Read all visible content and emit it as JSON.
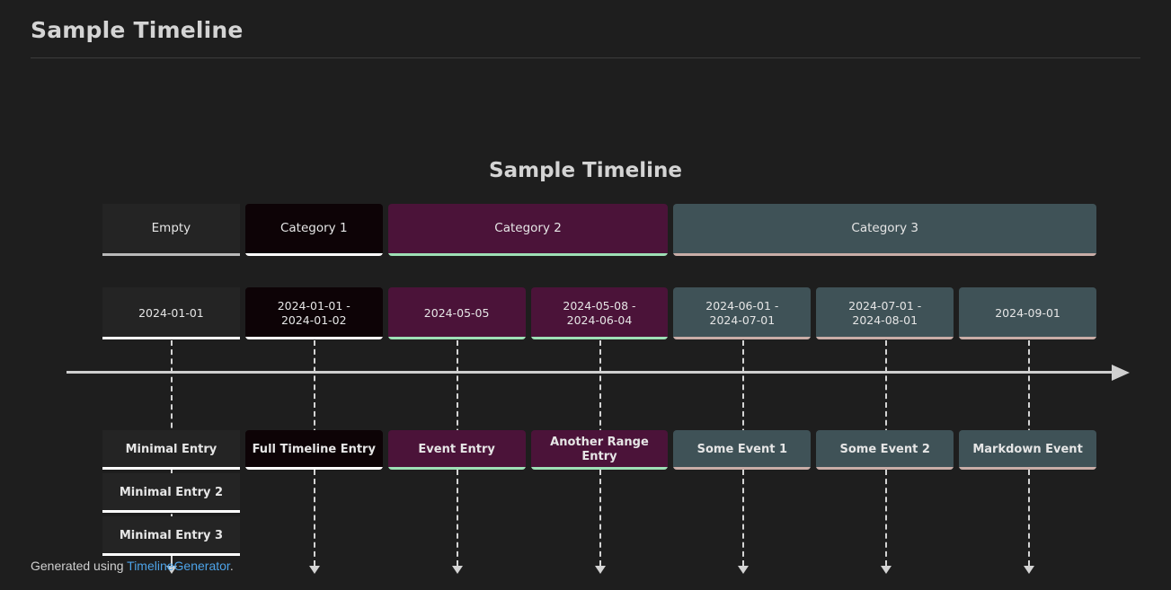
{
  "page": {
    "header_title": "Sample Timeline",
    "background_color": "#1e1e1e"
  },
  "chart_data": {
    "type": "table",
    "title": "Sample Timeline",
    "xlabel": "",
    "ylabel": "",
    "grid": false,
    "legend": "none",
    "axis": {
      "style": "arrow-right",
      "color": "#cfcfcf"
    },
    "categories": [
      {
        "label": "Empty",
        "bg_color": "#242424",
        "accent_color": "#b9b9b9",
        "span_columns": 1
      },
      {
        "label": "Category 1",
        "bg_color": "#0d0306",
        "accent_color": "#ffffff",
        "span_columns": 1
      },
      {
        "label": "Category 2",
        "bg_color": "#4b1339",
        "accent_color": "#9ee0b6",
        "span_columns": 2
      },
      {
        "label": "Category 3",
        "bg_color": "#3f5257",
        "accent_color": "#c9ada7",
        "span_columns": 3
      }
    ],
    "columns": [
      {
        "date": "2024-01-01",
        "event": "Minimal Entry",
        "category": "Empty",
        "bg_color": "#242424",
        "accent_color": "#ffffff",
        "extra_events": [
          "Minimal Entry 2",
          "Minimal Entry 3"
        ]
      },
      {
        "date": "2024-01-01 -\n2024-01-02",
        "event": "Full Timeline Entry",
        "category": "Category 1",
        "bg_color": "#0d0306",
        "accent_color": "#ffffff",
        "extra_events": []
      },
      {
        "date": "2024-05-05",
        "event": "Event Entry",
        "category": "Category 2",
        "bg_color": "#4b1339",
        "accent_color": "#9ee0b6",
        "extra_events": []
      },
      {
        "date": "2024-05-08 -\n2024-06-04",
        "event": "Another Range Entry",
        "category": "Category 2",
        "bg_color": "#4b1339",
        "accent_color": "#9ee0b6",
        "extra_events": []
      },
      {
        "date": "2024-06-01 -\n2024-07-01",
        "event": "Some Event 1",
        "category": "Category 3",
        "bg_color": "#3f5257",
        "accent_color": "#c9ada7",
        "extra_events": []
      },
      {
        "date": "2024-07-01 -\n2024-08-01",
        "event": "Some Event 2",
        "category": "Category 3",
        "bg_color": "#3f5257",
        "accent_color": "#c9ada7",
        "extra_events": []
      },
      {
        "date": "2024-09-01",
        "event": "Markdown Event",
        "category": "Category 3",
        "bg_color": "#3f5257",
        "accent_color": "#c9ada7",
        "extra_events": []
      }
    ]
  },
  "footer": {
    "prefix": "Generated using ",
    "link_label": "TimelineGenerator",
    "suffix": "."
  }
}
